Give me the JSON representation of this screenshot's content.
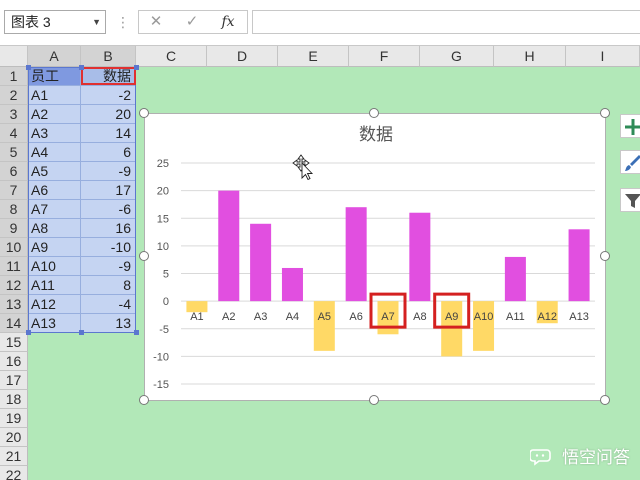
{
  "name_box": {
    "value": "图表 3",
    "arrow": "chevron-down-icon"
  },
  "formula_bar": {
    "sep": "⋮",
    "cancel": "✕",
    "enter": "✓",
    "fx": "fx",
    "input": ""
  },
  "columns": [
    "A",
    "B",
    "C",
    "D",
    "E",
    "F",
    "G",
    "H",
    "I"
  ],
  "rows": [
    "1",
    "2",
    "3",
    "4",
    "5",
    "6",
    "7",
    "8",
    "9",
    "10",
    "11",
    "12",
    "13",
    "14",
    "15",
    "16",
    "17",
    "18",
    "19",
    "20",
    "21",
    "22"
  ],
  "table": {
    "header": [
      "员工",
      "数据"
    ],
    "records": [
      [
        "A1",
        "-2"
      ],
      [
        "A2",
        "20"
      ],
      [
        "A3",
        "14"
      ],
      [
        "A4",
        "6"
      ],
      [
        "A5",
        "-9"
      ],
      [
        "A6",
        "17"
      ],
      [
        "A7",
        "-6"
      ],
      [
        "A8",
        "16"
      ],
      [
        "A9",
        "-10"
      ],
      [
        "A10",
        "-9"
      ],
      [
        "A11",
        "8"
      ],
      [
        "A12",
        "-4"
      ],
      [
        "A13",
        "13"
      ]
    ]
  },
  "side_buttons": [
    "plus-icon",
    "brush-icon",
    "filter-icon"
  ],
  "watermark": "悟空问答",
  "colors": {
    "positive": "#e14fe0",
    "negative": "#ffd966",
    "highlight": "#d42020"
  },
  "chart_data": {
    "type": "bar",
    "title": "数据",
    "categories": [
      "A1",
      "A2",
      "A3",
      "A4",
      "A5",
      "A6",
      "A7",
      "A8",
      "A9",
      "A10",
      "A11",
      "A12",
      "A13"
    ],
    "values": [
      -2,
      20,
      14,
      6,
      -9,
      17,
      -6,
      16,
      -10,
      -9,
      8,
      -4,
      13
    ],
    "ylim": [
      -15,
      25
    ],
    "yticks": [
      25,
      20,
      15,
      10,
      5,
      0,
      -5,
      -10,
      -15
    ],
    "grid": true,
    "highlighted_categories": [
      "A7",
      "A9"
    ]
  }
}
